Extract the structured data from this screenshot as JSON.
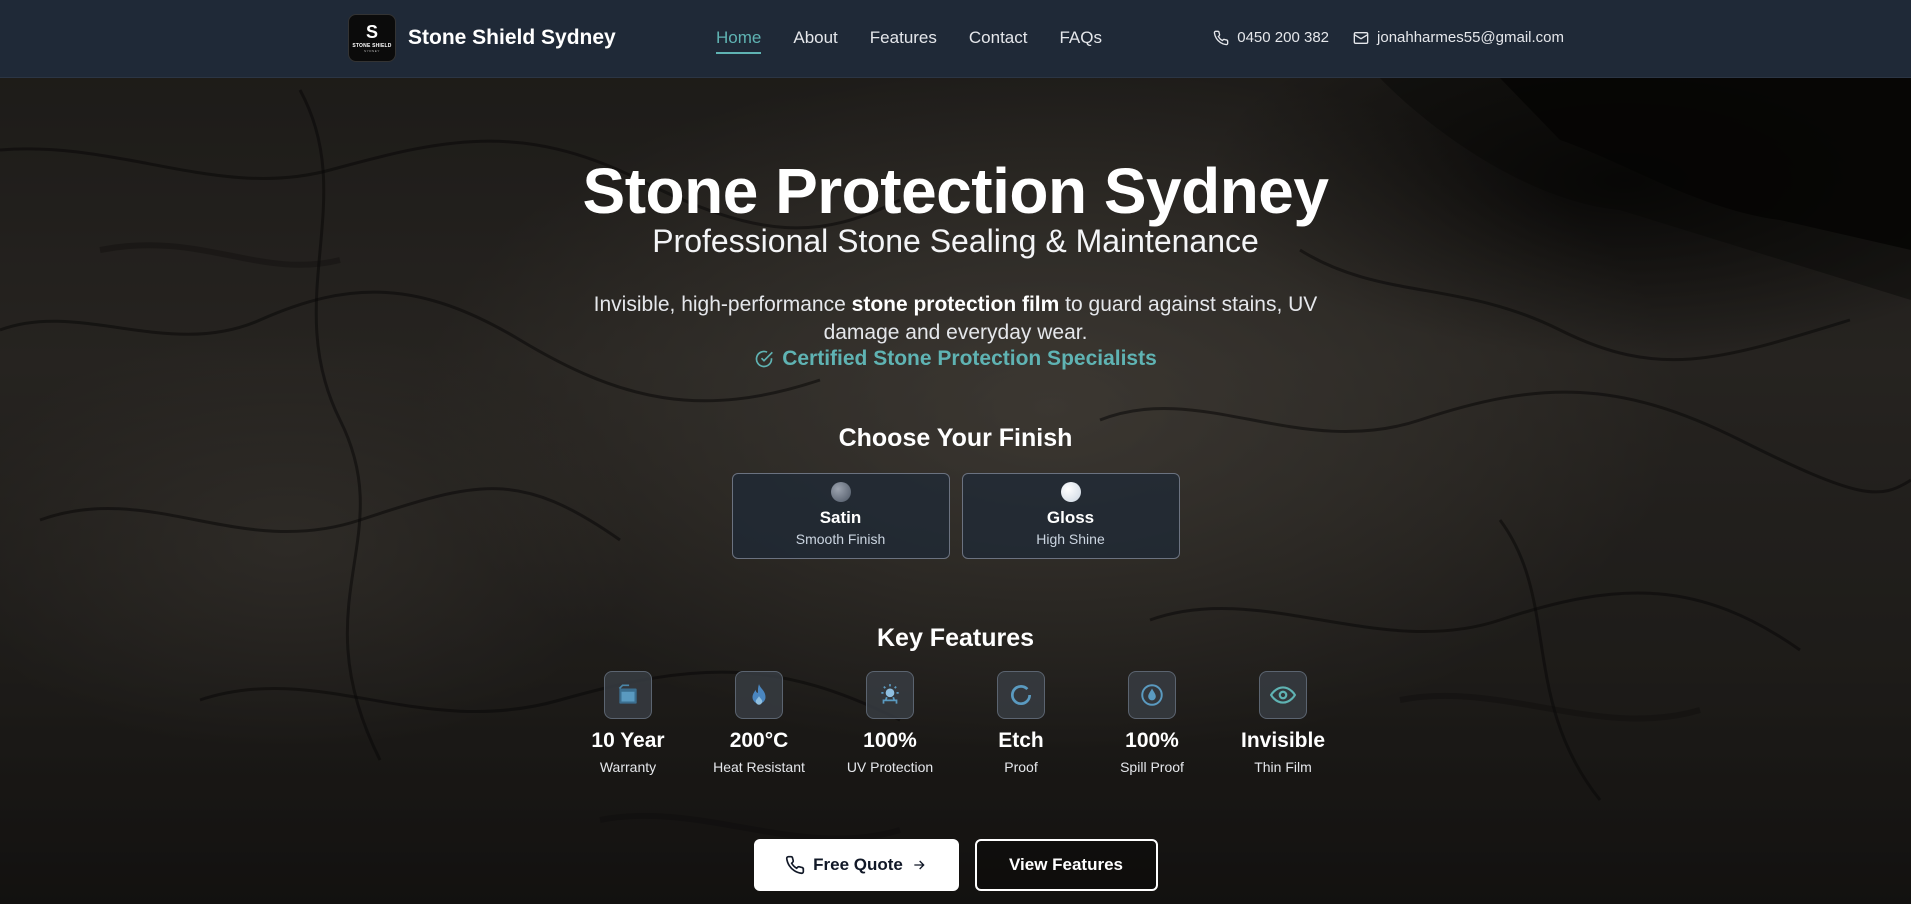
{
  "nav": {
    "brand": "Stone Shield Sydney",
    "logo_text": "STONE SHIELD",
    "logo_subtext": "SYDNEY",
    "links": [
      {
        "label": "Home",
        "active": true
      },
      {
        "label": "About",
        "active": false
      },
      {
        "label": "Features",
        "active": false
      },
      {
        "label": "Contact",
        "active": false
      },
      {
        "label": "FAQs",
        "active": false
      }
    ],
    "phone": "0450 200 382",
    "email": "jonahharmes55@gmail.com"
  },
  "hero": {
    "title": "Stone Protection Sydney",
    "subtitle": "Professional Stone Sealing & Maintenance",
    "desc_pre": "Invisible, high-performance ",
    "desc_bold": "stone protection film",
    "desc_post": " to guard against stains, UV damage and everyday wear.",
    "certified": "Certified Stone Protection Specialists"
  },
  "finish": {
    "title": "Choose Your Finish",
    "options": [
      {
        "name": "Satin",
        "desc": "Smooth Finish"
      },
      {
        "name": "Gloss",
        "desc": "High Shine"
      }
    ]
  },
  "features": {
    "title": "Key Features",
    "items": [
      {
        "value": "10 Year",
        "label": "Warranty",
        "icon": "shield-icon"
      },
      {
        "value": "200°C",
        "label": "Heat Resistant",
        "icon": "flame-icon"
      },
      {
        "value": "100%",
        "label": "UV Protection",
        "icon": "sun-icon"
      },
      {
        "value": "Etch",
        "label": "Proof",
        "icon": "circle-icon"
      },
      {
        "value": "100%",
        "label": "Spill Proof",
        "icon": "droplet-icon"
      },
      {
        "value": "Invisible",
        "label": "Thin Film",
        "icon": "eye-icon"
      }
    ]
  },
  "cta": {
    "quote": "Free Quote",
    "view": "View Features"
  },
  "colors": {
    "accent": "#5fb3b3",
    "nav_bg": "#1f2937"
  }
}
